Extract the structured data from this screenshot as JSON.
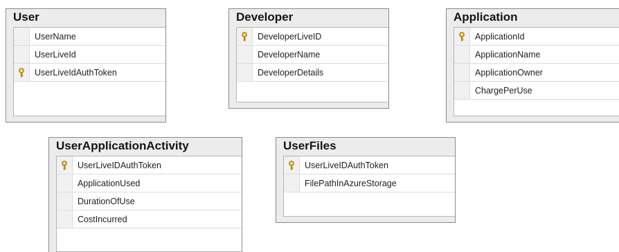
{
  "tables": {
    "user": {
      "title": "User",
      "columns": [
        {
          "name": "UserName",
          "primary_key": false
        },
        {
          "name": "UserLiveId",
          "primary_key": false
        },
        {
          "name": "UserLiveIdAuthToken",
          "primary_key": true
        }
      ]
    },
    "developer": {
      "title": "Developer",
      "columns": [
        {
          "name": "DeveloperLiveID",
          "primary_key": true
        },
        {
          "name": "DeveloperName",
          "primary_key": false
        },
        {
          "name": "DeveloperDetails",
          "primary_key": false
        }
      ]
    },
    "application": {
      "title": "Application",
      "columns": [
        {
          "name": "ApplicationId",
          "primary_key": true
        },
        {
          "name": "ApplicationName",
          "primary_key": false
        },
        {
          "name": "ApplicationOwner",
          "primary_key": false
        },
        {
          "name": "ChargePerUse",
          "primary_key": false
        }
      ]
    },
    "user_application_activity": {
      "title": "UserApplicationActivity",
      "columns": [
        {
          "name": "UserLiveIDAuthToken",
          "primary_key": true
        },
        {
          "name": "ApplicationUsed",
          "primary_key": false
        },
        {
          "name": "DurationOfUse",
          "primary_key": false
        },
        {
          "name": "CostIncurred",
          "primary_key": false
        }
      ]
    },
    "user_files": {
      "title": "UserFiles",
      "columns": [
        {
          "name": "UserLiveIDAuthToken",
          "primary_key": true
        },
        {
          "name": "FilePathInAzureStorage",
          "primary_key": false
        }
      ]
    }
  },
  "colors": {
    "table_background": "#ececec",
    "table_border": "#8a8a8a",
    "key_icon": "#d4a017"
  }
}
